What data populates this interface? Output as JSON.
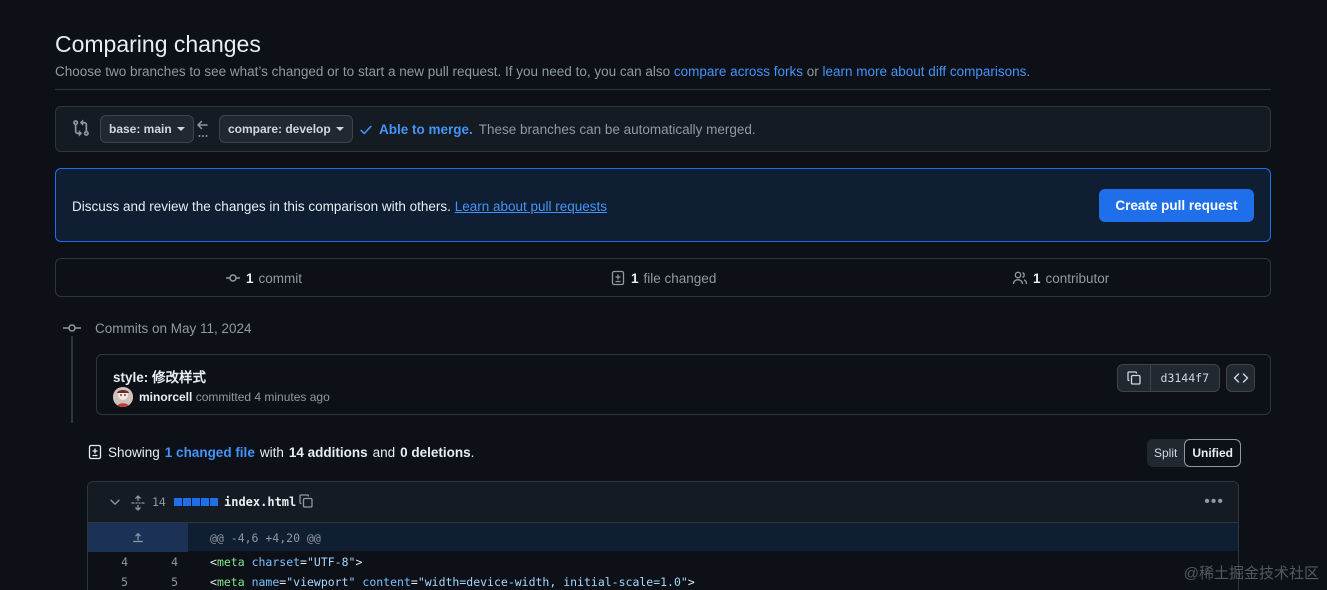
{
  "header": {
    "title": "Comparing changes",
    "subtitle": "Choose two branches to see what’s changed or to start a new pull request. If you need to, you can also",
    "link_forks": "compare across forks",
    "or": "or",
    "link_learn": "learn more about diff comparisons",
    "period": "."
  },
  "range": {
    "base_label": "base: main",
    "compare_label": "compare: develop",
    "merge_strong": "Able to merge.",
    "merge_text": "These branches can be automatically merged."
  },
  "flash": {
    "text": "Discuss and review the changes in this comparison with others.",
    "link": "Learn about pull requests",
    "button": "Create pull request"
  },
  "stats": {
    "commits_count": "1",
    "commits_label": "commit",
    "files_count": "1",
    "files_label": "file changed",
    "contributors_count": "1",
    "contributors_label": "contributor"
  },
  "commits": {
    "heading": "Commits on May 11, 2024",
    "message": "style: 修改样式",
    "author": "minorcell",
    "time": "committed 4 minutes ago",
    "sha": "d3144f7"
  },
  "summary": {
    "prefix": "Showing",
    "files_link": "1 changed file",
    "with": "with",
    "additions": "14 additions",
    "and": "and",
    "deletions": "0 deletions",
    "period": ".",
    "split": "Split",
    "unified": "Unified"
  },
  "file": {
    "changes": "14",
    "name": "index.html",
    "hunk": "@@ -4,6 +4,20 @@",
    "lines": [
      {
        "old": "4",
        "new": "4",
        "p1": "<",
        "tag": "meta",
        "a1": "charset",
        "eq1": "=",
        "v1": "\"UTF-8\"",
        "a2": "",
        "eq2": "",
        "v2": "",
        "end": ">"
      },
      {
        "old": "5",
        "new": "5",
        "p1": "<",
        "tag": "meta",
        "a1": "name",
        "eq1": "=",
        "v1": "\"viewport\"",
        "a2": "content",
        "eq2": "=",
        "v2": "\"width=device-width, initial-scale=1.0\"",
        "end": ">"
      }
    ]
  },
  "colors": {
    "bg": "#0d1117",
    "accent": "#1f6feb",
    "link": "#4493f8",
    "muted": "#9198a1",
    "border": "#30363d"
  },
  "watermark": "@稀土掘金技术社区"
}
